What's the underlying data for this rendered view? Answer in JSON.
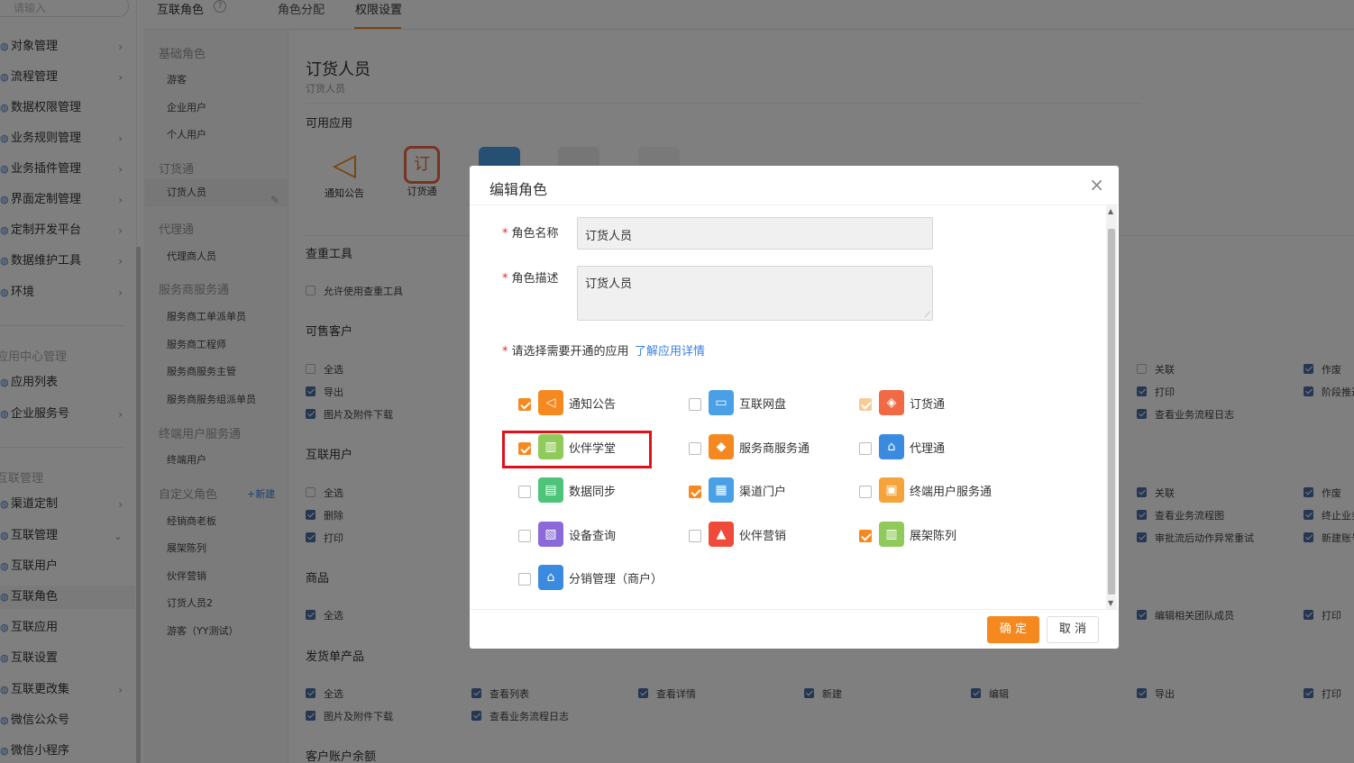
{
  "leftnav": {
    "search_placeholder": "请输入",
    "items": [
      {
        "label": "对象管理",
        "chev": "›"
      },
      {
        "label": "流程管理",
        "chev": "›"
      },
      {
        "label": "数据权限管理",
        "chev": ""
      },
      {
        "label": "业务规则管理",
        "chev": "›"
      },
      {
        "label": "业务插件管理",
        "chev": "›"
      },
      {
        "label": "界面定制管理",
        "chev": "›"
      },
      {
        "label": "定制开发平台",
        "chev": "›"
      },
      {
        "label": "数据维护工具",
        "chev": "›"
      },
      {
        "label": "环境",
        "chev": "›"
      }
    ],
    "section_app": "应用中心管理",
    "app_items": [
      {
        "label": "应用列表",
        "chev": ""
      },
      {
        "label": "企业服务号",
        "chev": "›"
      }
    ],
    "section_interconnect": "互联管理",
    "ic_items": [
      {
        "label": "渠道定制",
        "chev": "›"
      },
      {
        "label": "互联管理",
        "chev": "⌄"
      },
      {
        "label": "互联用户",
        "chev": ""
      },
      {
        "label": "互联角色",
        "chev": ""
      },
      {
        "label": "互联应用",
        "chev": ""
      },
      {
        "label": "互联设置",
        "chev": ""
      },
      {
        "label": "互联更改集",
        "chev": "›"
      },
      {
        "label": "微信公众号",
        "chev": ""
      },
      {
        "label": "微信小程序",
        "chev": ""
      }
    ]
  },
  "toptabs": {
    "title": "互联角色",
    "help": "?",
    "tab1": "角色分配",
    "tab2": "权限设置"
  },
  "rolelist": {
    "g1": "基础角色",
    "g1_items": [
      "游客",
      "企业用户",
      "个人用户"
    ],
    "g2": "订货通",
    "g2_items": [
      "订货人员"
    ],
    "g3": "代理通",
    "g3_items": [
      "代理商人员"
    ],
    "g4": "服务商服务通",
    "g4_items": [
      "服务商工单派单员",
      "服务商工程师",
      "服务商服务主管",
      "服务商服务组派单员"
    ],
    "g5": "终端用户服务通",
    "g5_items": [
      "终端用户"
    ],
    "g6": "自定义角色",
    "new_label": "+新建",
    "g6_items": [
      "经销商老板",
      "展架陈列",
      "伙伴营销",
      "订货人员2",
      "游客（YY测试）"
    ]
  },
  "main": {
    "title": "订货人员",
    "subtitle": "订货人员",
    "apps_title": "可用应用",
    "apps": [
      {
        "label": "通知公告"
      },
      {
        "label": "订货通"
      }
    ],
    "sec_tools": "查重工具",
    "tools_cb": "允许使用查重工具",
    "sec_customer": "可售客户",
    "cust_cbs": [
      "全选",
      "导出",
      "图片及附件下载"
    ],
    "cust_right": [
      "关联",
      "打印",
      "查看业务流程日志"
    ],
    "cust_far": [
      "作废",
      "阶段推进"
    ],
    "sec_users": "互联用户",
    "user_cbs": [
      "全选",
      "删除",
      "打印"
    ],
    "user_right": [
      "关联",
      "查看业务流程图",
      "审批流后动作异常重试"
    ],
    "user_far": [
      "作废",
      "终止业务",
      "新建账号"
    ],
    "sec_goods": "商品",
    "goods_cbs": [
      "全选"
    ],
    "goods_right": [
      "编辑相关团队成员"
    ],
    "goods_far": [
      "打印"
    ],
    "sec_ship": "发货单产品",
    "ship_row1": [
      "全选",
      "查看列表",
      "查看详情",
      "新建",
      "编辑",
      "导出",
      "打印"
    ],
    "ship_row2": [
      "图片及附件下载",
      "查看业务流程日志"
    ],
    "sec_balance": "客户账户余额"
  },
  "modal": {
    "title": "编辑角色",
    "close": "×",
    "name_label": "角色名称",
    "name_value": "订货人员",
    "desc_label": "角色描述",
    "desc_value": "订货人员",
    "apps_label": "请选择需要开通的应用",
    "apps_link": "了解应用详情",
    "options": [
      {
        "label": "通知公告",
        "state": "on",
        "color": "#f5891f",
        "icon": "◁"
      },
      {
        "label": "互联网盘",
        "state": "off",
        "color": "#4aa0e6",
        "icon": "▭"
      },
      {
        "label": "订货通",
        "state": "dis",
        "color": "#ef6a45",
        "icon": "◈"
      },
      {
        "label": "伙伴学堂",
        "state": "on",
        "color": "#8fca5a",
        "icon": "▥"
      },
      {
        "label": "服务商服务通",
        "state": "off",
        "color": "#f5891f",
        "icon": "◆"
      },
      {
        "label": "代理通",
        "state": "off",
        "color": "#3a8be0",
        "icon": "⌂"
      },
      {
        "label": "数据同步",
        "state": "off",
        "color": "#4cc47a",
        "icon": "▤"
      },
      {
        "label": "渠道门户",
        "state": "on",
        "color": "#4aa0e6",
        "icon": "▦"
      },
      {
        "label": "终端用户服务通",
        "state": "off",
        "color": "#f5a33a",
        "icon": "▣"
      },
      {
        "label": "设备查询",
        "state": "off",
        "color": "#8a6ad8",
        "icon": "▧"
      },
      {
        "label": "伙伴营销",
        "state": "off",
        "color": "#ef4a3a",
        "icon": "▲"
      },
      {
        "label": "展架陈列",
        "state": "on",
        "color": "#8fca5a",
        "icon": "▥"
      },
      {
        "label": "分销管理（商户）",
        "state": "off",
        "color": "#3a8be0",
        "icon": "⌂"
      }
    ],
    "ok_label": "确 定",
    "cancel_label": "取 消"
  }
}
